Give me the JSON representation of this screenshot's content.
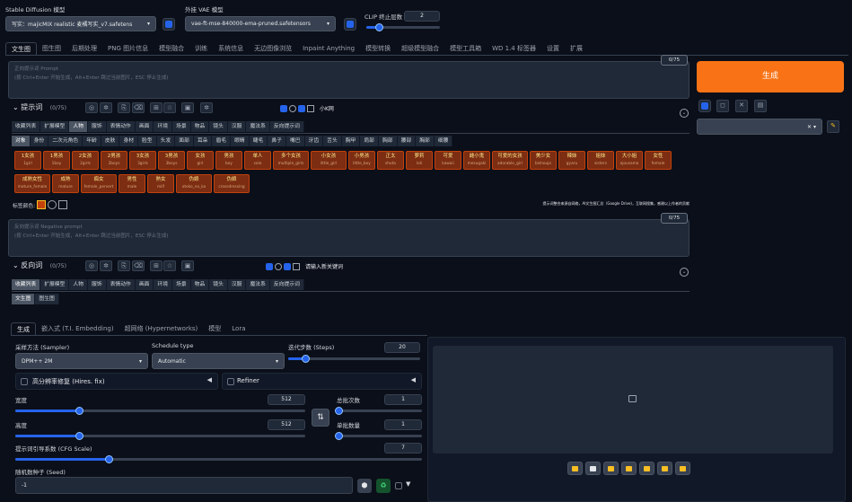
{
  "top": {
    "sd_label": "Stable Diffusion 模型",
    "sd_value": "写实：majicMIX realistic 麦橘写实_v7.safetens",
    "vae_label": "外挂 VAE 模型",
    "vae_value": "vae-ft-mse-840000-ema-pruned.safetensors",
    "clip_label": "CLIP 终止层数",
    "clip_value": "2",
    "clip_level": 0.17
  },
  "main_tabs": [
    "文生图",
    "图生图",
    "后期处理",
    "PNG 图片信息",
    "模型融合",
    "训练",
    "系统信息",
    "无边图像浏览",
    "Inpaint Anything",
    "模型转换",
    "超级模型融合",
    "模型工具箱",
    "WD 1.4 标签器",
    "设置",
    "扩展"
  ],
  "prompt": {
    "placeholder_1": "正向提示词 Prompt",
    "placeholder_2": "(按 Ctrl+Enter 开始生成，Alt+Enter 跳过当前图片，ESC 停止生成)",
    "counter": "0/75"
  },
  "generate_label": "生成",
  "pos_bar": {
    "title": "提示词",
    "count": "(0/75)",
    "small_label": "小K网"
  },
  "neg_bar": {
    "title": "反向词",
    "count": "(0/75)",
    "keyword_placeholder": "请输入新关键词"
  },
  "categories": [
    "收藏列表",
    "扩展模型",
    "人物",
    "服饰",
    "表情动作",
    "画面",
    "环境",
    "场景",
    "物品",
    "镜头",
    "汉服",
    "魔法系",
    "反向提示词"
  ],
  "subcats": [
    "对象",
    "身份",
    "二次元角色",
    "年龄",
    "皮肤",
    "身材",
    "脸型",
    "头发",
    "面部",
    "耳朵",
    "眉毛",
    "眼睛",
    "睫毛",
    "鼻子",
    "嘴巴",
    "牙齿",
    "舌头",
    "胸甲",
    "肩部",
    "胸部",
    "腰部",
    "胸部",
    "细腰"
  ],
  "tags": [
    {
      "cn": "1女孩",
      "en": "1girl"
    },
    {
      "cn": "1男孩",
      "en": "1boy"
    },
    {
      "cn": "2女孩",
      "en": "2girls"
    },
    {
      "cn": "2男孩",
      "en": "2boys"
    },
    {
      "cn": "3女孩",
      "en": "3girls"
    },
    {
      "cn": "3男孩",
      "en": "3boys"
    },
    {
      "cn": "女孩",
      "en": "girl"
    },
    {
      "cn": "男孩",
      "en": "boy"
    },
    {
      "cn": "单人",
      "en": "solo"
    },
    {
      "cn": "多个女孩",
      "en": "multiple_girls"
    },
    {
      "cn": "小女孩",
      "en": "little_girl"
    },
    {
      "cn": "小男孩",
      "en": "little_boy"
    },
    {
      "cn": "正太",
      "en": "shota"
    },
    {
      "cn": "萝莉",
      "en": "loli"
    },
    {
      "cn": "可爱",
      "en": "kawaii"
    },
    {
      "cn": "雌小鬼",
      "en": "mesugaki"
    },
    {
      "cn": "可爱的女孩",
      "en": "adorable_girl"
    },
    {
      "cn": "美少女",
      "en": "bishoujo"
    },
    {
      "cn": "辣妹",
      "en": "gyaru"
    },
    {
      "cn": "姐妹",
      "en": "sisters"
    },
    {
      "cn": "大小姐",
      "en": "ojousama"
    },
    {
      "cn": "女性",
      "en": "female"
    },
    {
      "cn": "成熟女性",
      "en": "mature_female"
    },
    {
      "cn": "成熟",
      "en": "mature"
    },
    {
      "cn": "痴女",
      "en": "female_pervert"
    },
    {
      "cn": "男性",
      "en": "male"
    },
    {
      "cn": "熟女",
      "en": "milf"
    },
    {
      "cn": "伪娘",
      "en": "otoko_no_ko"
    },
    {
      "cn": "伪娘",
      "en": "crossdressing"
    }
  ],
  "tag_color_label": "标签颜色:",
  "note": "提示词整合来源自网络，AI文生图汇总（Google Drive)，互联网搜集，感谢以上作者的贡献",
  "neg_prompt": {
    "placeholder_1": "反向提示词 Negative prompt",
    "placeholder_2": "(按 Ctrl+Enter 开始生成，Alt+Enter 跳过当前图片，ESC 停止生成)",
    "counter": "0/75"
  },
  "neg_sub": [
    "文生图",
    "图生图"
  ],
  "gen_tabs": [
    "生成",
    "嵌入式 (T.I. Embedding)",
    "超网络 (Hypernetworks)",
    "模型",
    "Lora"
  ],
  "sampler": {
    "label": "采样方法 (Sampler)",
    "value": "DPM++ 2M"
  },
  "schedule": {
    "label": "Schedule type",
    "value": "Automatic"
  },
  "steps": {
    "label": "迭代步数 (Steps)",
    "value": "20",
    "level": 0.13
  },
  "hires_label": "高分辨率修复 (Hires. fix)",
  "refiner_label": "Refiner",
  "width": {
    "label": "宽度",
    "value": "512",
    "level": 0.22
  },
  "height": {
    "label": "高度",
    "value": "512",
    "level": 0.22
  },
  "batch_count": {
    "label": "总批次数",
    "value": "1",
    "level": 0.02
  },
  "batch_size": {
    "label": "单批数量",
    "value": "1",
    "level": 0.02
  },
  "cfg": {
    "label": "提示词引导系数 (CFG Scale)",
    "value": "7",
    "level": 0.23
  },
  "seed": {
    "label": "随机数种子 (Seed)",
    "value": "-1"
  },
  "colors": {
    "accent": "#2563eb",
    "generate": "#f97316",
    "tag_bg": "#7c2d12"
  }
}
